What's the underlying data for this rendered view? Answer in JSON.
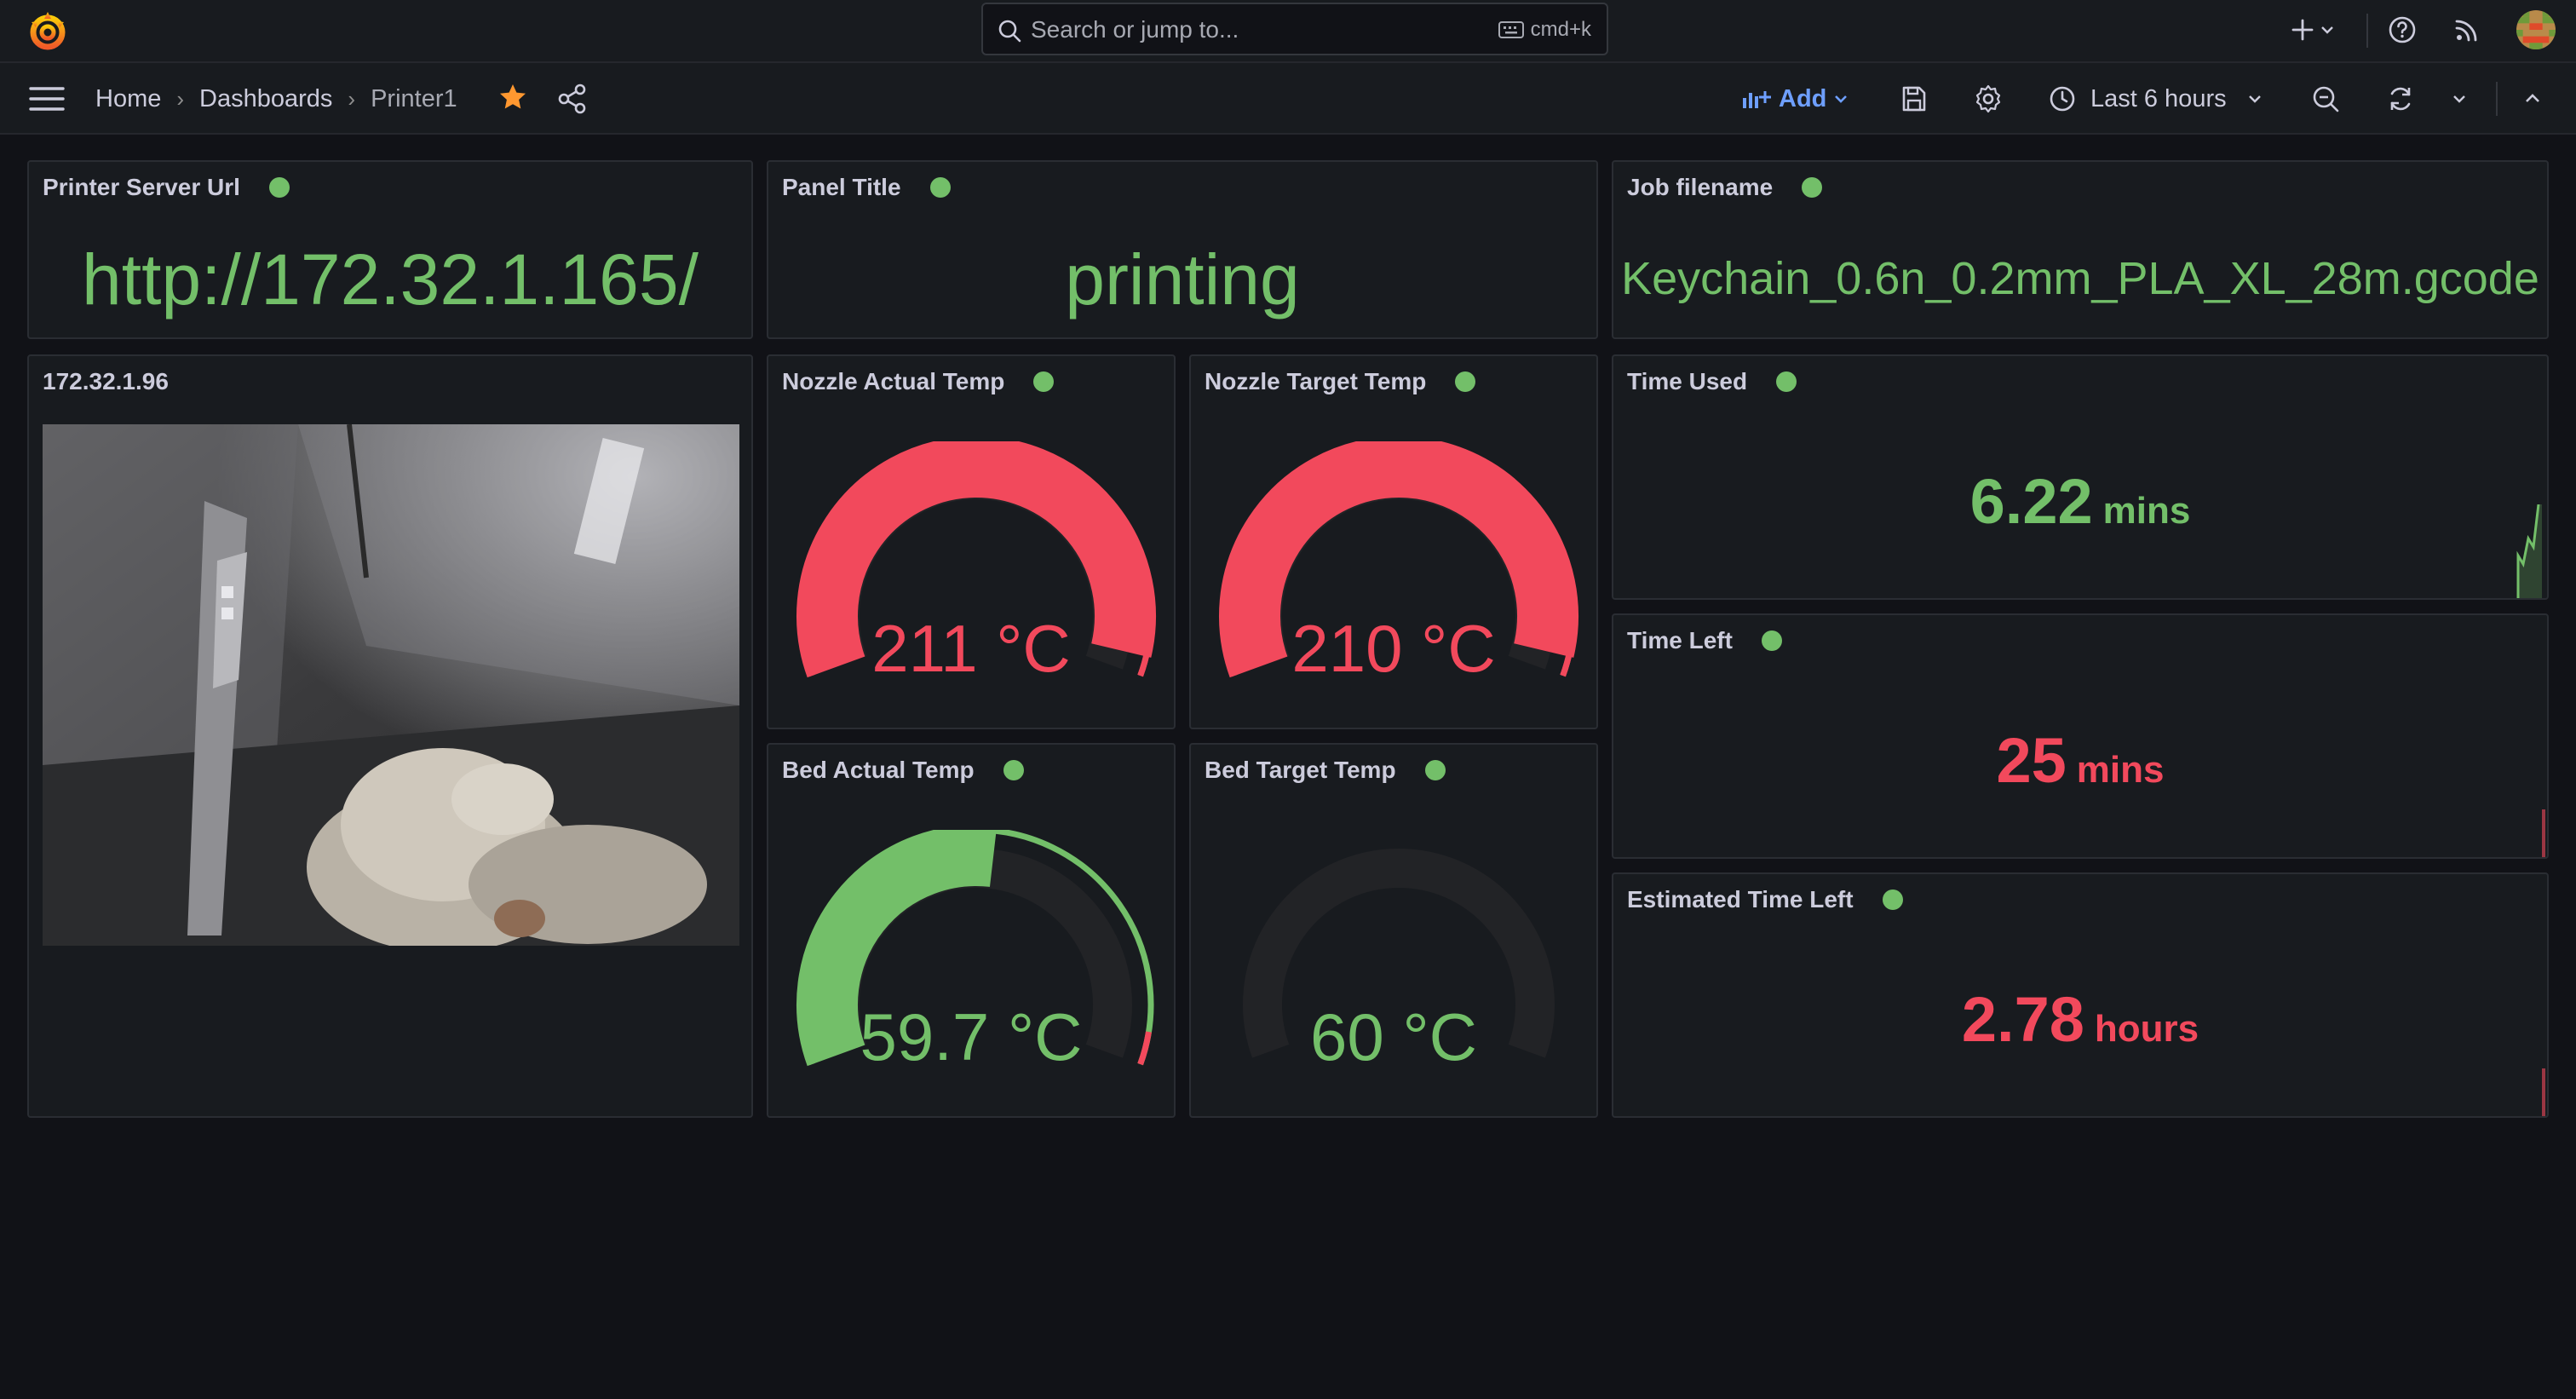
{
  "topbar": {
    "search_placeholder": "Search or jump to...",
    "search_shortcut": "cmd+k"
  },
  "breadcrumb": {
    "home": "Home",
    "dashboards": "Dashboards",
    "current": "Printer1"
  },
  "toolbar": {
    "add_label": "Add",
    "time_range": "Last 6 hours"
  },
  "panels": {
    "server_url": {
      "title": "Printer Server Url",
      "value": "http://172.32.1.165/"
    },
    "status": {
      "title": "Panel Title",
      "value": "printing"
    },
    "job": {
      "title": "Job filename",
      "value": "Keychain_0.6n_0.2mm_PLA_XL_28m.gcode"
    },
    "camera": {
      "title": "172.32.1.96"
    },
    "nozzle_actual": {
      "title": "Nozzle Actual Temp",
      "value": "211 °C",
      "fill": 0.97,
      "color": "#f2495c"
    },
    "nozzle_target": {
      "title": "Nozzle Target Temp",
      "value": "210 °C",
      "fill": 0.97,
      "color": "#f2495c"
    },
    "bed_actual": {
      "title": "Bed Actual Temp",
      "value": "59.7 °C",
      "fill": 0.53,
      "color": "#73bf69"
    },
    "bed_target": {
      "title": "Bed Target Temp",
      "value": "60 °C",
      "fill": 0.0,
      "color": "#73bf69"
    },
    "time_used": {
      "title": "Time Used",
      "value": "6.22",
      "unit": "mins"
    },
    "time_left": {
      "title": "Time Left",
      "value": "25",
      "unit": "mins"
    },
    "est_time_left": {
      "title": "Estimated Time Left",
      "value": "2.78",
      "unit": "hours"
    }
  },
  "colors": {
    "green": "#73bf69",
    "red": "#f2495c",
    "background": "#111217",
    "panel": "#181b1f",
    "accent": "#6e9fff",
    "star": "#ff9830"
  }
}
